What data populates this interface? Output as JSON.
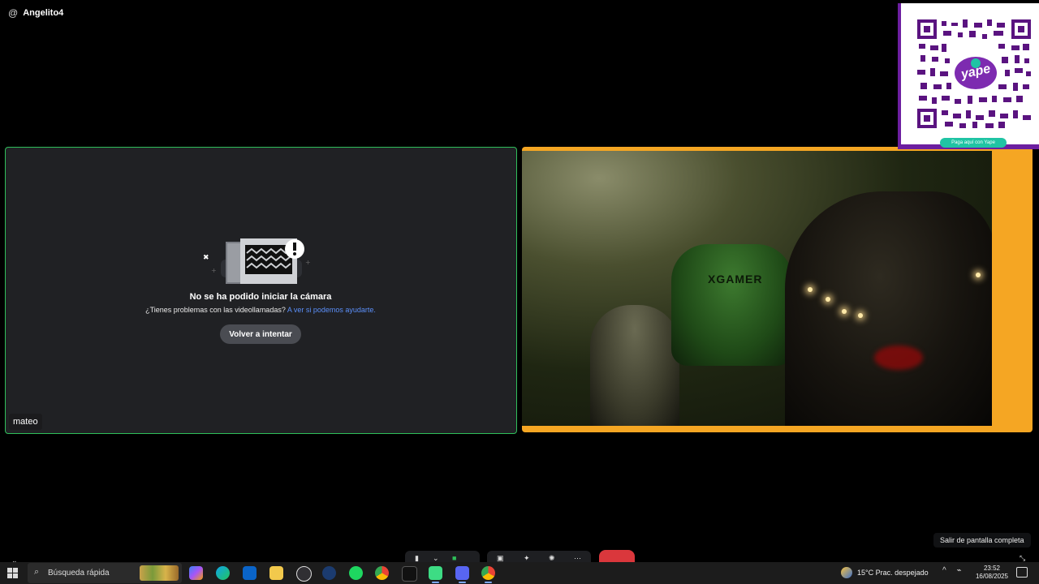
{
  "header": {
    "at_symbol": "@",
    "username": "Angelito4"
  },
  "left_tile": {
    "participant_name": "mateo",
    "error_title": "No se ha podido iniciar la cámara",
    "help_text": "¿Tienes problemas con las videollamadas?",
    "help_link": "A ver si podemos ayudarte.",
    "retry_label": "Volver a intentar"
  },
  "right_tile": {
    "chair_brand": "XGAMER"
  },
  "qr_card": {
    "brand": "yape",
    "pill_text": "Paga aquí con Yape",
    "accent": "#6c1fa0"
  },
  "tooltip": {
    "fullscreen_exit": "Salir de pantalla completa"
  },
  "taskbar": {
    "search_placeholder": "Búsqueda rápida",
    "apps": [
      "copilot-icon",
      "edge-icon",
      "outlook-icon",
      "file-explorer-icon",
      "obs-icon",
      "steam-icon",
      "spotify-icon",
      "chrome-icon",
      "tiktok-icon",
      "android-icon",
      "discord-icon",
      "chrome-profile-icon"
    ],
    "weather": "15°C  Prac. despejado",
    "time": "23:52",
    "date": "16/08/2025"
  },
  "colors": {
    "speaking_border": "#f5a623",
    "active_border": "#2fbf5a",
    "end_call": "#da373c",
    "link": "#5b8ff9"
  }
}
